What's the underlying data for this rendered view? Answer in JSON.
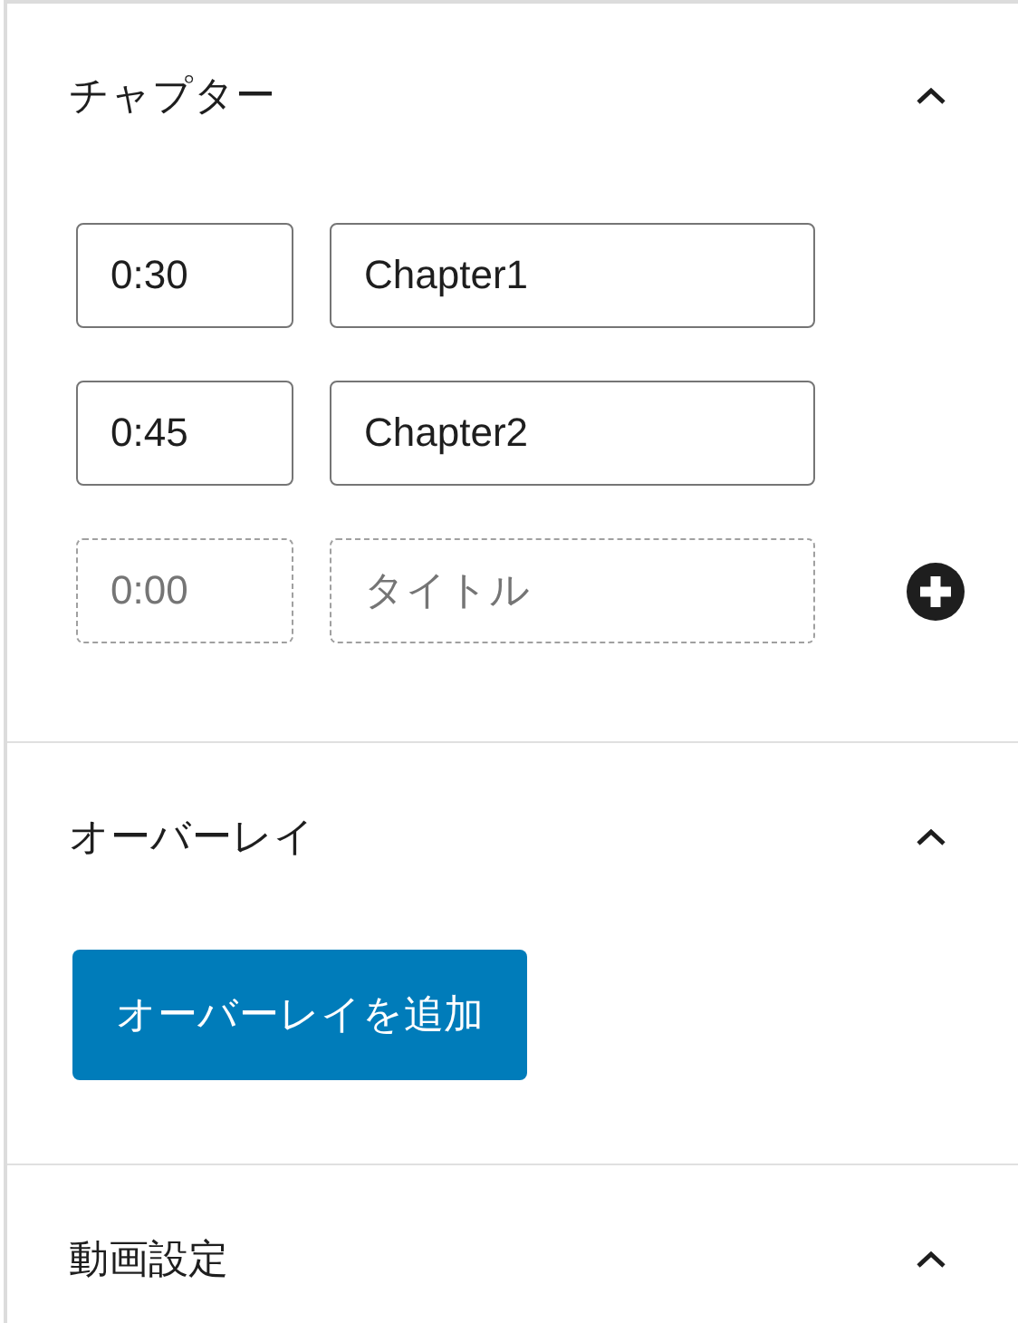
{
  "panels": [
    {
      "kind": "chapters",
      "title": "チャプター",
      "expanded": true,
      "chapters": [
        {
          "time": "0:30",
          "title": "Chapter1"
        },
        {
          "time": "0:45",
          "title": "Chapter2"
        }
      ],
      "new_chapter": {
        "time_placeholder": "0:00",
        "title_placeholder": "タイトル"
      }
    },
    {
      "kind": "overlay",
      "title": "オーバーレイ",
      "expanded": true,
      "button": "オーバーレイを追加"
    },
    {
      "kind": "settings",
      "title": "動画設定",
      "expanded": true
    }
  ]
}
